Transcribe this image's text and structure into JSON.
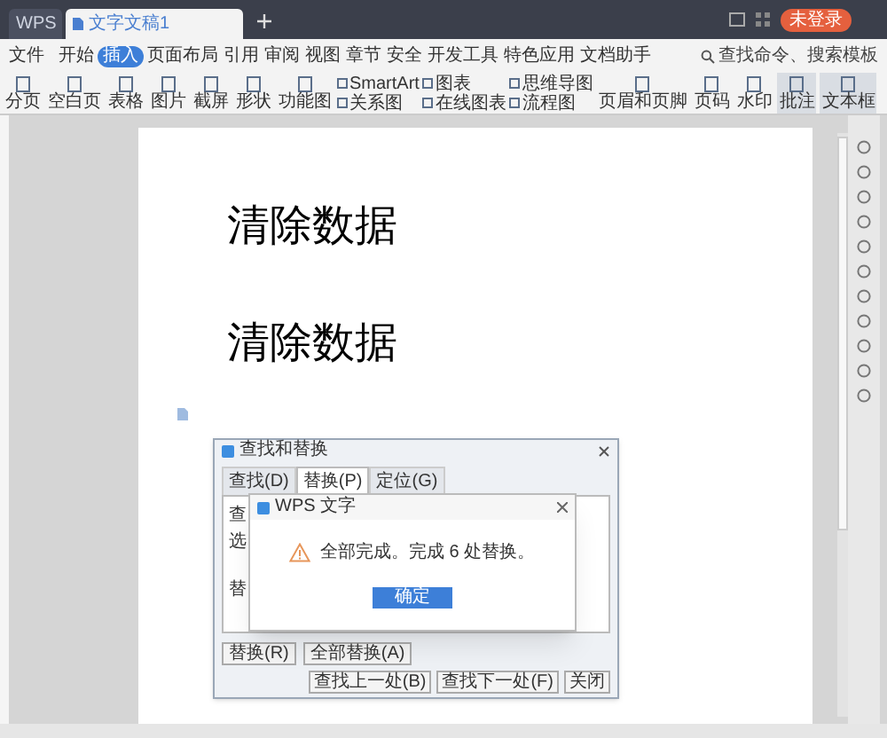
{
  "tabs": [
    {
      "label": "WPS",
      "selected": false
    },
    {
      "label": "文字文稿1",
      "selected": true
    }
  ],
  "account_button": "未登录",
  "menu": {
    "file": "文件",
    "items": [
      {
        "label": "开始",
        "selected": false
      },
      {
        "label": "插入",
        "selected": true
      },
      {
        "label": "页面布局",
        "selected": false
      },
      {
        "label": "引用",
        "selected": false
      },
      {
        "label": "审阅",
        "selected": false
      },
      {
        "label": "视图",
        "selected": false
      },
      {
        "label": "章节",
        "selected": false
      },
      {
        "label": "安全",
        "selected": false
      },
      {
        "label": "开发工具",
        "selected": false
      },
      {
        "label": "特色应用",
        "selected": false
      },
      {
        "label": "文档助手",
        "selected": false
      }
    ],
    "search": {
      "placeholder": "查找命令、搜索模板"
    }
  },
  "ribbon": [
    {
      "kind": "large",
      "label": "分页",
      "highlighted": false
    },
    {
      "kind": "large",
      "label": "空白页",
      "highlighted": false
    },
    {
      "kind": "large",
      "label": "表格",
      "highlighted": false
    },
    {
      "kind": "large",
      "label": "图片",
      "highlighted": false
    },
    {
      "kind": "large",
      "label": "截屏",
      "highlighted": false
    },
    {
      "kind": "large",
      "label": "形状",
      "highlighted": false
    },
    {
      "kind": "large",
      "label": "功能图",
      "highlighted": false
    },
    {
      "kind": "stack",
      "items": [
        "SmartArt",
        "关系图"
      ]
    },
    {
      "kind": "stack",
      "items": [
        "图表",
        "在线图表"
      ]
    },
    {
      "kind": "stack",
      "items": [
        "思维导图",
        "流程图"
      ]
    },
    {
      "kind": "large",
      "label": "页眉和页脚",
      "highlighted": false
    },
    {
      "kind": "large",
      "label": "页码",
      "highlighted": false
    },
    {
      "kind": "large",
      "label": "水印",
      "highlighted": false
    },
    {
      "kind": "large",
      "label": "批注",
      "highlighted": true
    },
    {
      "kind": "large",
      "label": "文本框",
      "highlighted": true
    }
  ],
  "document": {
    "paragraphs": [
      "清除数据",
      "清除数据"
    ]
  },
  "find_dialog": {
    "title": "查找和替换",
    "tabs": [
      {
        "label": "查找(D)",
        "selected": false
      },
      {
        "label": "替换(P)",
        "selected": true
      },
      {
        "label": "定位(G)",
        "selected": false
      }
    ],
    "labels": [
      "查",
      "选",
      "替"
    ],
    "buttons": [
      "替换(R)",
      "全部替换(A)"
    ],
    "footer_buttons": [
      "查找上一处(B)",
      "查找下一处(F)",
      "关闭"
    ]
  },
  "message_box": {
    "title": "WPS 文字",
    "message": "全部完成。完成 6 处替换。",
    "button": "确定"
  }
}
